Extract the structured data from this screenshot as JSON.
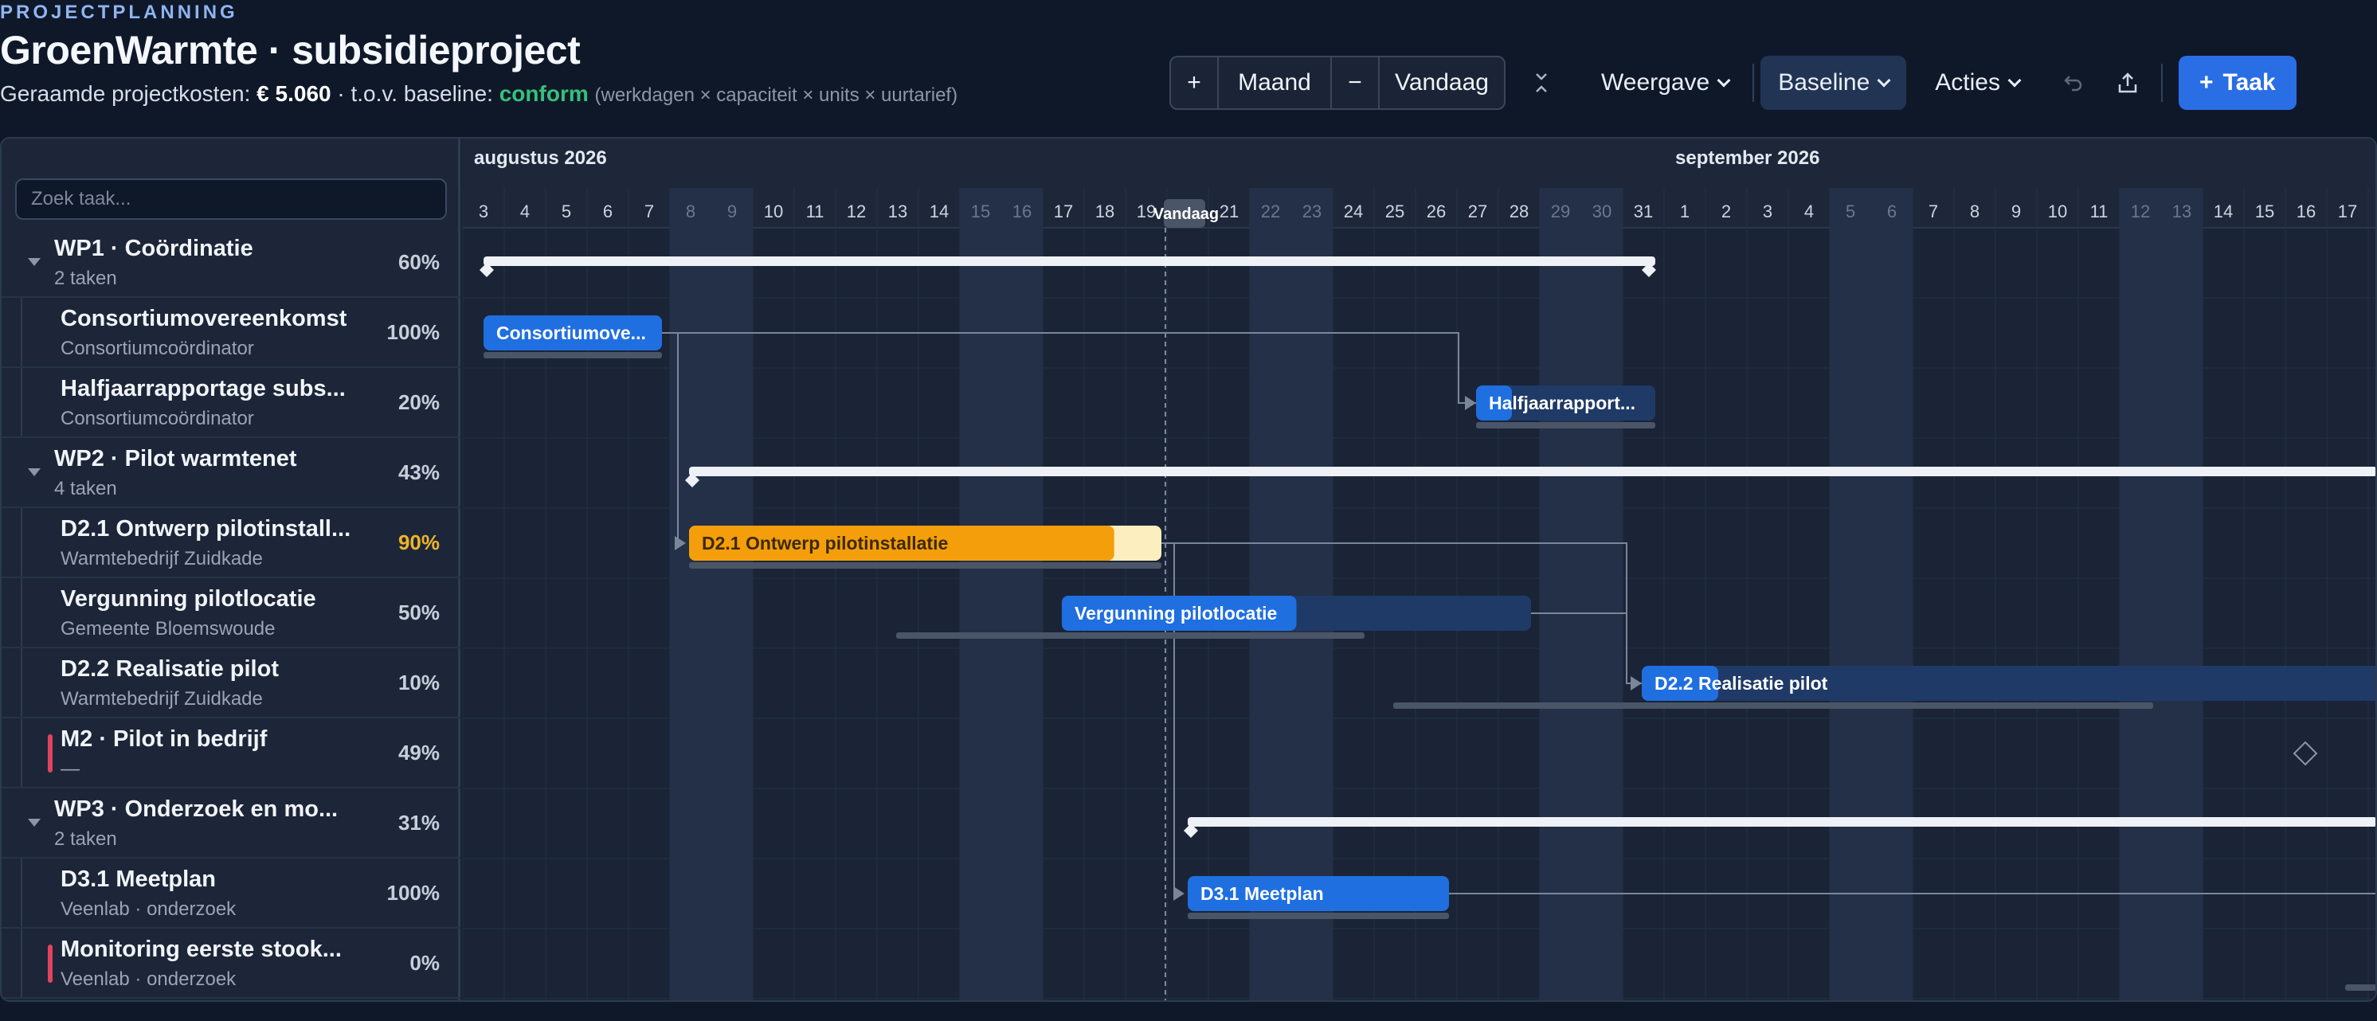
{
  "header": {
    "eyebrow": "PROJECTPLANNING",
    "title": "GroenWarmte · subsidieproject",
    "cost_label": "Geraamde projectkosten:",
    "cost_value": "€ 5.060",
    "baseline_label": "· t.o.v. baseline:",
    "baseline_status": "conform",
    "formula_hint": "(werkdagen × capaciteit × units × uurtarief)"
  },
  "toolbar": {
    "zoom_in": "+",
    "zoom_level": "Maand",
    "zoom_out": "−",
    "today": "Vandaag",
    "view": "Weergave",
    "baseline": "Baseline",
    "actions": "Acties",
    "add_task": "Taak",
    "add_task_icon": "+"
  },
  "search": {
    "placeholder": "Zoek taak..."
  },
  "timeline": {
    "months": [
      {
        "label": "augustus 2026",
        "col": 0
      },
      {
        "label": "september 2026",
        "col": 29
      }
    ],
    "days": [
      "3",
      "4",
      "5",
      "6",
      "7",
      "8",
      "9",
      "10",
      "11",
      "12",
      "13",
      "14",
      "15",
      "16",
      "17",
      "18",
      "19",
      "Vandaag",
      "21",
      "22",
      "23",
      "24",
      "25",
      "26",
      "27",
      "28",
      "29",
      "30",
      "31",
      "1",
      "2",
      "3",
      "4",
      "5",
      "6",
      "7",
      "8",
      "9",
      "10",
      "11",
      "12",
      "13",
      "14",
      "15",
      "16",
      "17"
    ],
    "weekend_cols": [
      5,
      6,
      12,
      13,
      19,
      20,
      26,
      27,
      33,
      34,
      40,
      41
    ],
    "today_col": 17
  },
  "rows": [
    {
      "type": "group",
      "name": "WP1 · Coördinatie",
      "sub": "2 taken",
      "pct": "60%"
    },
    {
      "type": "task",
      "name": "Consortiumovereenkomst",
      "sub": "Consortiumcoördinator",
      "pct": "100%"
    },
    {
      "type": "task",
      "name": "Halfjaarrapportage subs...",
      "sub": "Consortiumcoördinator",
      "pct": "20%"
    },
    {
      "type": "group",
      "name": "WP2 · Pilot warmtenet",
      "sub": "4 taken",
      "pct": "43%"
    },
    {
      "type": "task",
      "name": "D2.1 Ontwerp pilotinstall...",
      "sub": "Warmtebedrijf Zuidkade",
      "pct": "90%",
      "warn": true
    },
    {
      "type": "task",
      "name": "Vergunning pilotlocatie",
      "sub": "Gemeente Bloemswoude",
      "pct": "50%"
    },
    {
      "type": "task",
      "name": "D2.2 Realisatie pilot",
      "sub": "Warmtebedrijf Zuidkade",
      "pct": "10%"
    },
    {
      "type": "milestone",
      "name": "M2 · Pilot in bedrijf",
      "sub": "—",
      "pct": "49%"
    },
    {
      "type": "group",
      "name": "WP3 · Onderzoek en mo...",
      "sub": "2 taken",
      "pct": "31%"
    },
    {
      "type": "task",
      "name": "D3.1 Meetplan",
      "sub": "Veenlab · onderzoek",
      "pct": "100%"
    },
    {
      "type": "milestone",
      "name": "Monitoring eerste stook...",
      "sub": "Veenlab · onderzoek",
      "pct": "0%"
    }
  ],
  "bars": {
    "consortium": "Consortiumove...",
    "halfjaar": "Halfjaarrapport...",
    "d21": "D2.1 Ontwerp pilotinstallatie",
    "vergunning": "Vergunning pilotlocatie",
    "d22": "D2.2 Realisatie pilot",
    "d31": "D3.1 Meetplan"
  },
  "colors": {
    "accent": "#2a6ee6",
    "task_bar": "#1f6fe0",
    "critical_bar": "#f59e0b",
    "summary_bar": "#eef1f5",
    "ok": "#37c07a",
    "milestone_mark": "#e0455d"
  }
}
